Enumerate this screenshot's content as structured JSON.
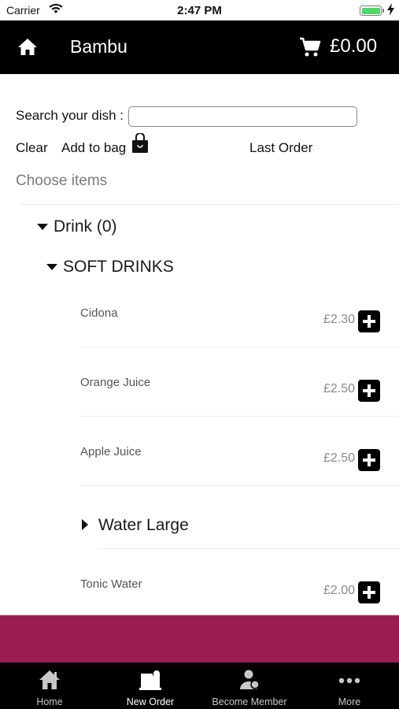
{
  "status_bar": {
    "carrier": "Carrier",
    "time": "2:47 PM"
  },
  "header": {
    "title": "Bambu",
    "cart_total": "£0.00"
  },
  "search": {
    "label": "Search your dish :",
    "value": "",
    "placeholder": ""
  },
  "actions": {
    "clear": "Clear",
    "add_to_bag": "Add to bag",
    "last_order": "Last Order"
  },
  "choose_label": "Choose items",
  "menu": {
    "category": "Drink (0)",
    "subcategory": "SOFT DRINKS",
    "items": [
      {
        "name": "Cidona",
        "price": "£2.30"
      },
      {
        "name": "Orange Juice",
        "price": "£2.50"
      },
      {
        "name": "Apple Juice",
        "price": "£2.50"
      }
    ],
    "collapsed_group": "Water Large",
    "last_item": {
      "name": "Tonic Water",
      "price": "£2.00"
    }
  },
  "tabs": [
    {
      "label": "Home",
      "icon": "home-icon"
    },
    {
      "label": "New Order",
      "icon": "new-order-icon"
    },
    {
      "label": "Become Member",
      "icon": "member-icon"
    },
    {
      "label": "More",
      "icon": "more-icon"
    }
  ],
  "colors": {
    "header": "#000000",
    "banner": "#9c1c52",
    "tabbar": "#000000",
    "battery": "#4cd964"
  }
}
